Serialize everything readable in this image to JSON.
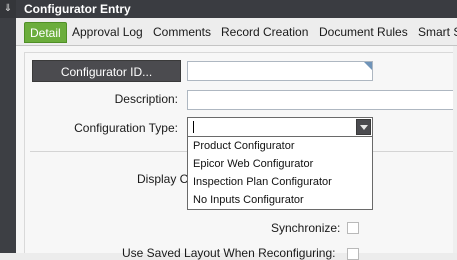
{
  "window": {
    "title": "Configurator Entry",
    "pin_glyph": "⇓"
  },
  "tabs": [
    {
      "label": "Detail"
    },
    {
      "label": "Approval Log"
    },
    {
      "label": "Comments"
    },
    {
      "label": "Record Creation"
    },
    {
      "label": "Document Rules"
    },
    {
      "label": "Smart St"
    }
  ],
  "form": {
    "configurator_id_button": "Configurator ID...",
    "configurator_id_value": "",
    "description_label": "Description:",
    "description_value": "",
    "config_type_label": "Configuration Type:",
    "config_type_value": "",
    "display_label_partial": "Display C",
    "synchronize_label": "Synchronize:",
    "use_saved_layout_label": "Use Saved Layout When Reconfiguring:"
  },
  "dropdown": {
    "options": [
      "Product Configurator",
      "Epicor Web Configurator",
      "Inspection Plan Configurator",
      "No Inputs Configurator"
    ]
  },
  "colors": {
    "active_tab": "#6bad3c",
    "dark_button": "#4b4b4f",
    "titlebar": "#3a3c41"
  }
}
